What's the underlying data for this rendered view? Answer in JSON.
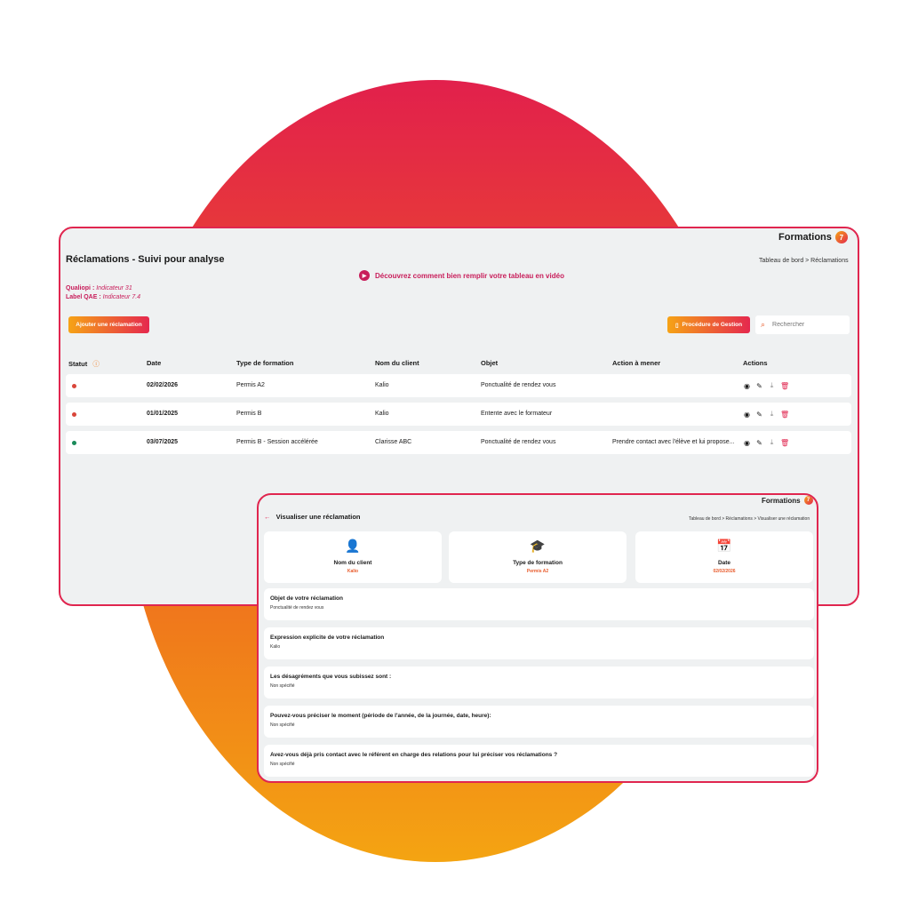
{
  "colors": {
    "accent": "#e0264f",
    "orange": "#f07a1b",
    "pink_text": "#c81d5a",
    "active_dot": "#1a8a5a",
    "inactive_dot": "#d9463a"
  },
  "main": {
    "brand": "Formations",
    "title": "Réclamations - Suivi pour analyse",
    "video_link": "Découvrez comment bien remplir votre tableau en vidéo",
    "breadcrumb": "Tableau de bord  >  Réclamations",
    "qualiopi_label": "Qualiopi :",
    "qualiopi_value": "Indicateur 31",
    "qae_label": "Label QAE :",
    "qae_value": "Indicateur 7.4",
    "add_button": "Ajouter une réclamation",
    "procedure_button": "Procédure de Gestion",
    "search_placeholder": "Rechercher",
    "columns": [
      "Statut",
      "Date",
      "Type de formation",
      "Nom du client",
      "Objet",
      "Action à mener",
      "Actions"
    ],
    "rows": [
      {
        "status": "red",
        "date": "02/02/2026",
        "type": "Permis A2",
        "client": "Kalio",
        "objet": "Ponctualité de rendez vous",
        "action": ""
      },
      {
        "status": "red",
        "date": "01/01/2025",
        "type": "Permis B",
        "client": "Kalio",
        "objet": "Entente avec le formateur",
        "action": ""
      },
      {
        "status": "green",
        "date": "03/07/2025",
        "type": "Permis B - Session accélérée",
        "client": "Clarisse ABC",
        "objet": "Ponctualité de rendez vous",
        "action": "Prendre contact avec l'élève et lui propose..."
      }
    ]
  },
  "detail": {
    "brand": "Formations",
    "title": "Visualiser une réclamation",
    "breadcrumb": "Tableau de bord  >  Réclamations  >  Visualiser une réclamation",
    "cards": [
      {
        "icon": "user-icon",
        "label": "Nom du client",
        "value": "Kalio"
      },
      {
        "icon": "graduation-cap-icon",
        "label": "Type de formation",
        "value": "Permis A2"
      },
      {
        "icon": "calendar-icon",
        "label": "Date",
        "value": "02/02/2026"
      }
    ],
    "panels": [
      {
        "question": "Objet de votre réclamation",
        "answer": "Ponctualité de rendez vous"
      },
      {
        "question": "Expression explicite de votre réclamation",
        "answer": "Kalio"
      },
      {
        "question": "Les désagréments que vous subissez sont :",
        "answer": "Non spécifié"
      },
      {
        "question": "Pouvez-vous préciser le moment (période de l'année, de la journée, date, heure):",
        "answer": "Non spécifié"
      },
      {
        "question": "Avez-vous déjà pris contact avec le référent en charge des relations pour lui préciser vos réclamations ?",
        "answer": "Non spécifié"
      }
    ]
  }
}
